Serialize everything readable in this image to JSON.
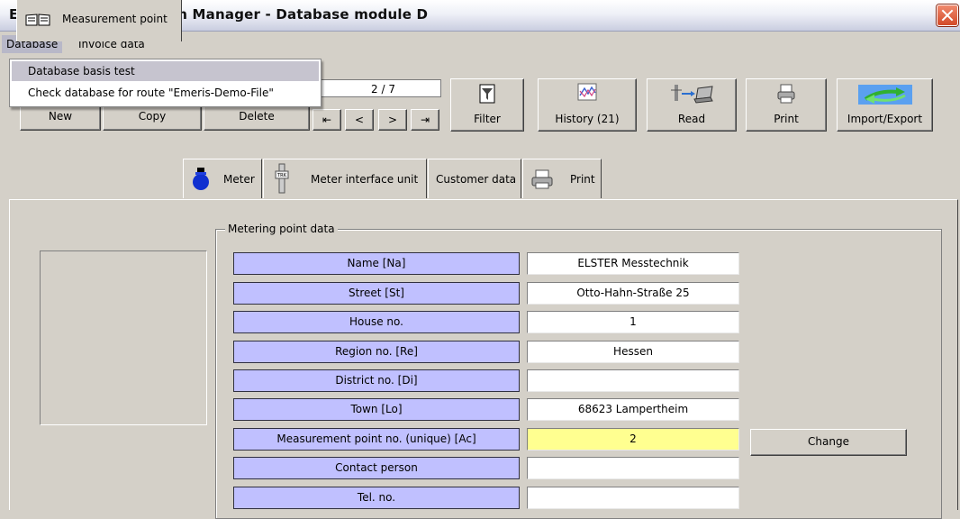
{
  "window": {
    "title": "Emeris Communication Manager - Database module D"
  },
  "menubar": {
    "items": [
      "Database",
      "Invoice data"
    ]
  },
  "dropdown": {
    "items": [
      "Database basis test",
      "Check database for route \"Emeris-Demo-File\""
    ]
  },
  "record": {
    "position": "2 / 7"
  },
  "toolbar": {
    "new": "New",
    "copy": "Copy",
    "delete": "Delete",
    "first": "⇤",
    "prev": "<",
    "next": ">",
    "last": "⇥",
    "filter": "Filter",
    "history": "History (21)",
    "read": "Read",
    "print": "Print",
    "import_export": "Import/Export"
  },
  "tabs": [
    "Measurement point",
    "Meter",
    "Meter interface unit",
    "Customer data",
    "Print"
  ],
  "group": {
    "title": "Metering point data"
  },
  "fields": [
    {
      "label": "Name  [Na]",
      "value": "ELSTER Messtechnik"
    },
    {
      "label": "Street  [St]",
      "value": "Otto-Hahn-Straße 25"
    },
    {
      "label": "House no.",
      "value": "1"
    },
    {
      "label": "Region no.  [Re]",
      "value": "Hessen"
    },
    {
      "label": "District no.  [Di]",
      "value": ""
    },
    {
      "label": "Town  [Lo]",
      "value": "68623 Lampertheim"
    },
    {
      "label": "Measurement point no. (unique)  [Ac]",
      "value": "2"
    },
    {
      "label": "Contact person",
      "value": ""
    },
    {
      "label": "Tel. no.",
      "value": ""
    }
  ],
  "change_button": "Change",
  "colors": {
    "label_bg": "#c0c0ff",
    "highlight_value": "#ffff90",
    "window_bg": "#d4d0c8"
  }
}
